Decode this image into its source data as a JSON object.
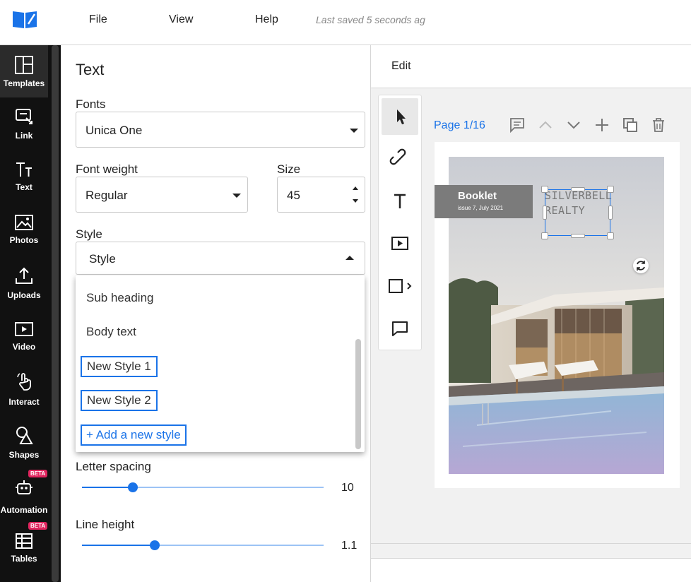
{
  "topbar": {
    "menu": [
      "File",
      "View",
      "Help"
    ],
    "saved_status": "Last saved 5 seconds ag"
  },
  "nav": {
    "items": [
      {
        "label": "Templates",
        "icon": "layout-icon",
        "active": true
      },
      {
        "label": "Link",
        "icon": "link-icon"
      },
      {
        "label": "Text",
        "icon": "text-icon"
      },
      {
        "label": "Photos",
        "icon": "image-icon"
      },
      {
        "label": "Uploads",
        "icon": "upload-icon"
      },
      {
        "label": "Video",
        "icon": "video-icon"
      },
      {
        "label": "Interact",
        "icon": "touch-icon"
      },
      {
        "label": "Shapes",
        "icon": "shapes-icon"
      },
      {
        "label": "Automation",
        "icon": "robot-icon",
        "badge": "BETA"
      },
      {
        "label": "Tables",
        "icon": "table-icon",
        "badge": "BETA"
      }
    ]
  },
  "panel": {
    "title": "Text",
    "fonts_label": "Fonts",
    "font_value": "Unica One",
    "weight_label": "Font weight",
    "weight_value": "Regular",
    "size_label": "Size",
    "size_value": "45",
    "style_label": "Style",
    "style_value": "Style",
    "style_options": [
      "Sub heading",
      "Body text",
      "New Style 1",
      "New Style 2"
    ],
    "add_style": "+ Add a new style",
    "letter_spacing_label": "Letter spacing",
    "letter_spacing_value": "10",
    "letter_spacing_fraction": 0.21,
    "line_height_label": "Line height",
    "line_height_value": "1.1",
    "line_height_fraction": 0.3
  },
  "editor": {
    "edit_label": "Edit",
    "page_info": "Page 1/16",
    "tools": [
      "pointer-icon",
      "link-icon",
      "text-icon",
      "video-icon",
      "rectangle-icon",
      "comment-icon"
    ],
    "page_actions": [
      "comment-icon",
      "chevron-up-icon",
      "chevron-down-icon",
      "plus-icon",
      "duplicate-icon",
      "trash-icon"
    ],
    "booklet_title": "Booklet",
    "booklet_subtitle": "issue 7, July 2021",
    "selected_text_line1": "SILVERBELL",
    "selected_text_line2": "REALTY"
  },
  "colors": {
    "accent": "#1a73e8",
    "nav_bg": "#111111",
    "beta": "#e0245e"
  }
}
